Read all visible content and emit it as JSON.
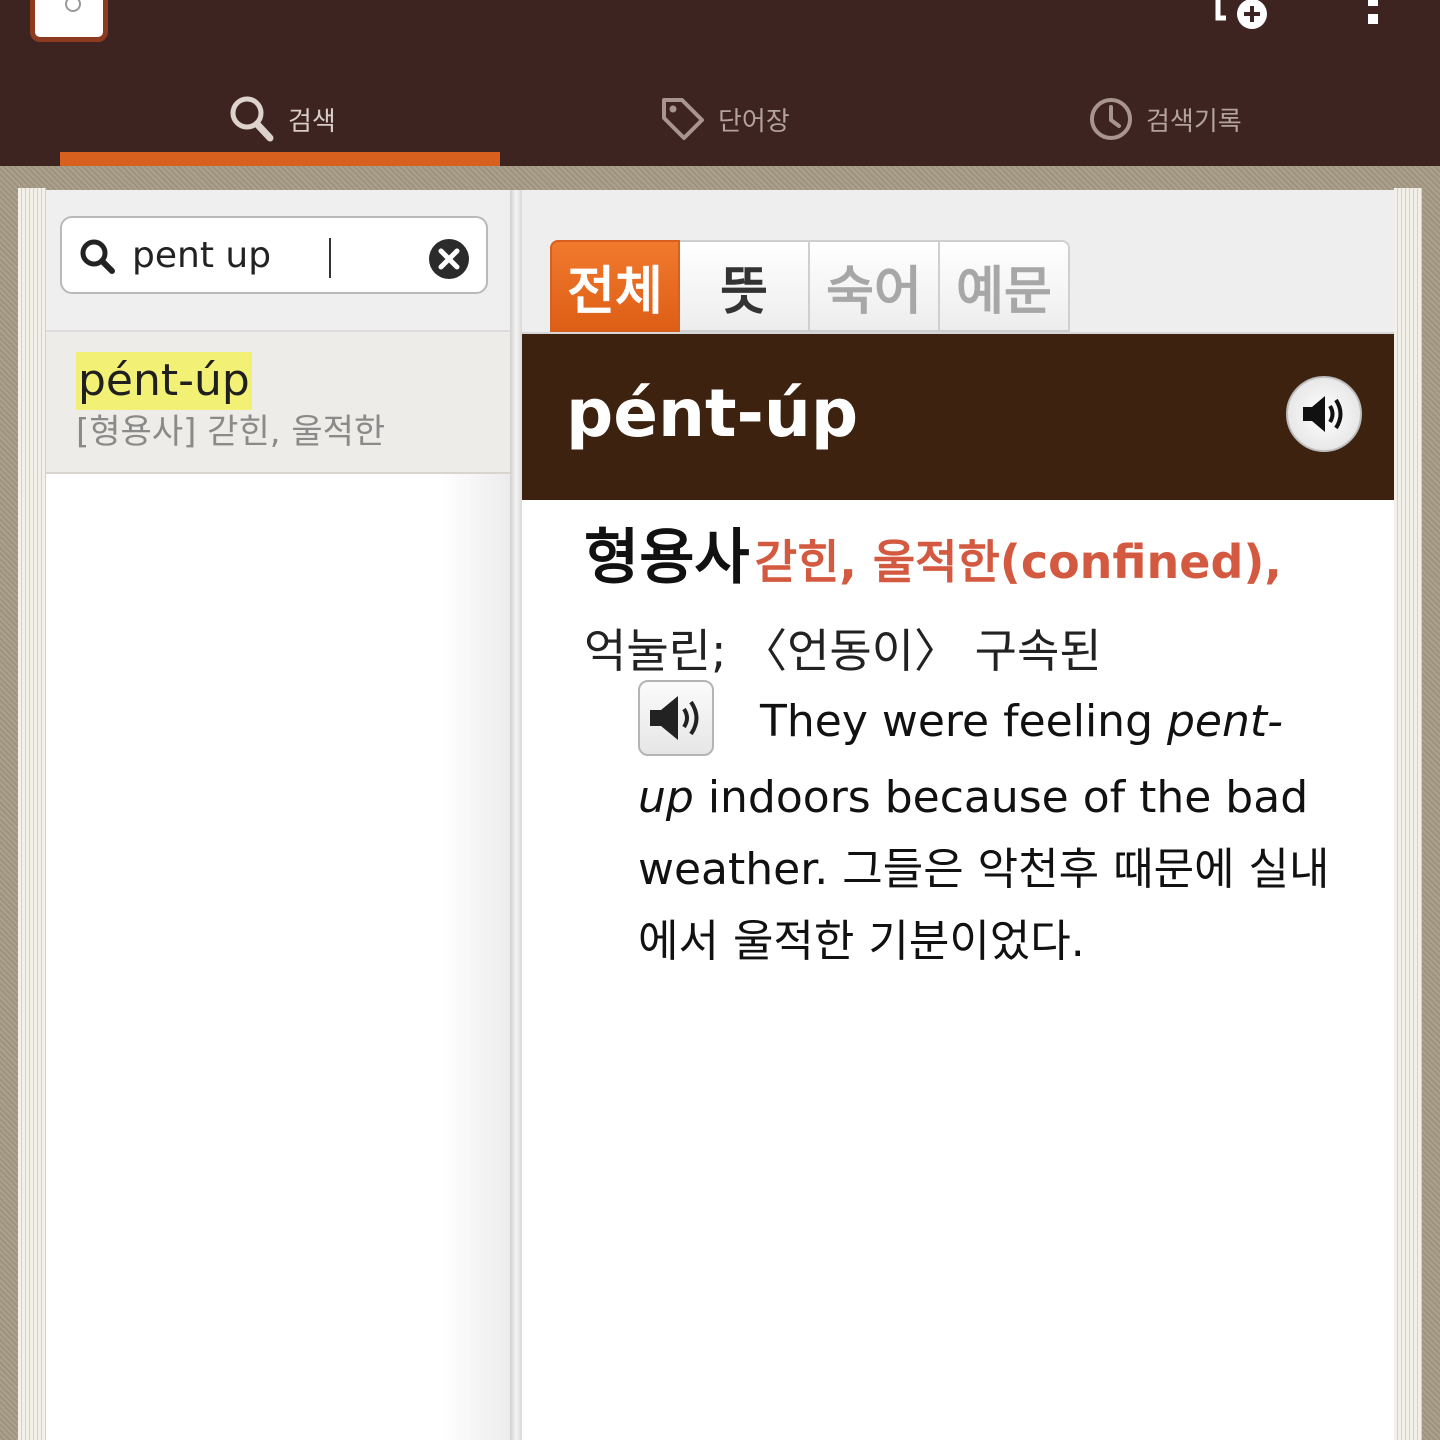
{
  "tabs": {
    "search": "검색",
    "wordbook": "단어장",
    "history": "검색기록"
  },
  "search": {
    "value": "pent up"
  },
  "results": [
    {
      "headword": "pént-úp",
      "summary": "[형용사] 갇힌, 울적한"
    }
  ],
  "filters": [
    "전체",
    "뜻",
    "숙어",
    "예문"
  ],
  "entry": {
    "headword": "pént-úp",
    "part_of_speech": "형용사",
    "meaning_main": "갇힌, 울적한(confined),",
    "meaning_rest": "억눌린; 〈언동이〉 구속된",
    "example_pre": "They were feeling ",
    "example_em": "pent-up",
    "example_post": " indoors because of the bad weather. 그들은 악천후 때문에 실내에서 울적한 기분이었다."
  },
  "colors": {
    "appbar": "#3d2420",
    "accent": "#d8601e",
    "headword_band": "#3d2210",
    "meaning_red": "#d35a40",
    "highlight": "#f3f175"
  }
}
